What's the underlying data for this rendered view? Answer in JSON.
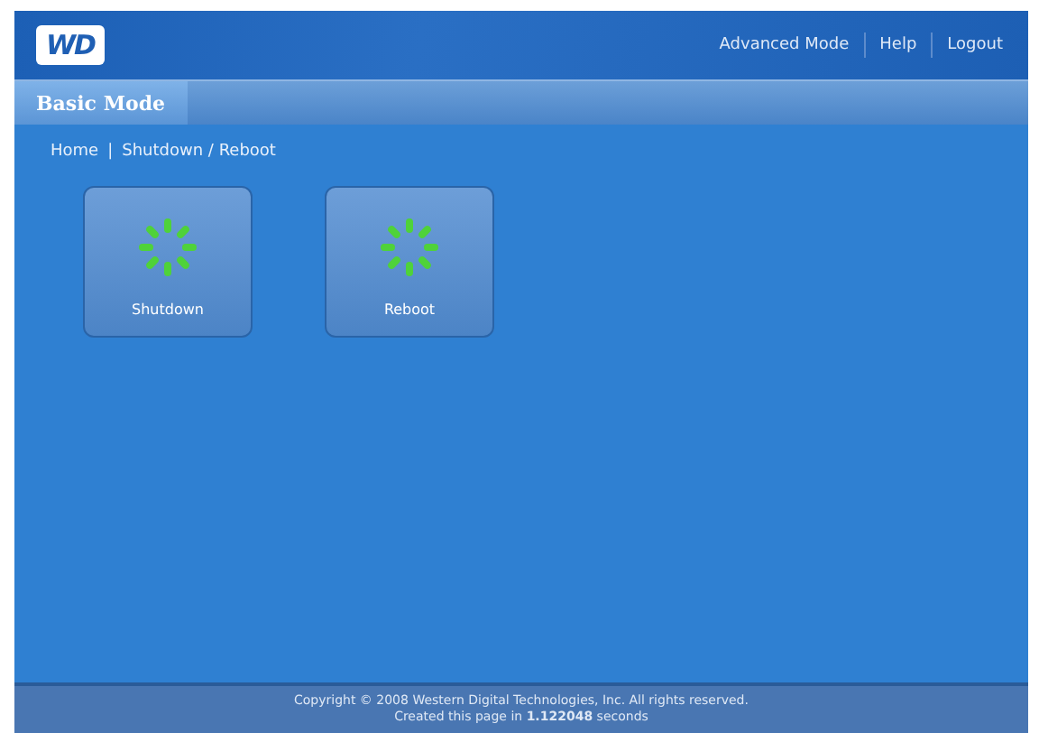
{
  "header": {
    "logo": "WD",
    "links": [
      "Advanced Mode",
      "Help",
      "Logout"
    ]
  },
  "tabs": [
    {
      "label": "Basic Mode",
      "selected": true
    }
  ],
  "breadcrumb": {
    "items": [
      "Home",
      "Shutdown / Reboot"
    ],
    "separator": "|"
  },
  "actions": [
    {
      "label": "Shutdown"
    },
    {
      "label": "Reboot"
    }
  ],
  "footer": {
    "copyright": "Copyright © 2008 Western Digital Technologies, Inc. All rights reserved.",
    "timing": "Created this page in **1.122048** seconds"
  }
}
